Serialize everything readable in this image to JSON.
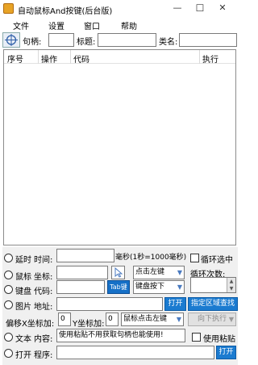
{
  "window": {
    "title": "自动鼠标And按键(后台版)",
    "minimize": "—",
    "maximize": "☐",
    "close": "✕"
  },
  "menu": [
    "文件",
    "设置",
    "窗口",
    "帮助"
  ],
  "fields": {
    "handle_label": "句柄:",
    "handle_value": "",
    "title_label": "标题:",
    "title_value": "",
    "class_label": "类名:",
    "class_value": ""
  },
  "table": {
    "columns": [
      "序号",
      "操作",
      "代码",
      "执行"
    ],
    "rows": []
  },
  "panel": {
    "delay": {
      "radio": "延时",
      "time_label": "时间:",
      "value": "",
      "unit": "毫秒(1秒=1000毫秒)",
      "loop_check": "循环选中"
    },
    "mouse": {
      "radio": "鼠标",
      "coord_label": "坐标:",
      "value": "",
      "click_select": "点击左键",
      "loop_count_label": "循环次数:"
    },
    "keyboard": {
      "radio": "键盘",
      "code_label": "代码:",
      "value": "",
      "tab_button": "Tab键",
      "key_select": "键盘按下"
    },
    "image": {
      "radio": "图片",
      "addr_label": "地址:",
      "value": "",
      "open_button": "打开",
      "area_button": "指定区域查找"
    },
    "offset": {
      "x_label": "偏移X坐标加:",
      "x_value": "0",
      "y_label": "Y坐标加:",
      "y_value": "0",
      "click_select": "鼠标点击左键",
      "exec_select": "向下执行"
    },
    "text": {
      "radio": "文本",
      "content_label": "内容:",
      "value": "使用粘贴不用获取句柄也能使用!",
      "paste_check": "使用粘贴"
    },
    "open": {
      "radio": "打开",
      "program_label": "程序:",
      "value": "",
      "open_button": "打开"
    }
  },
  "colors": {
    "accent": "#1b7bd0",
    "panel_bg": "#f0f0f0"
  }
}
